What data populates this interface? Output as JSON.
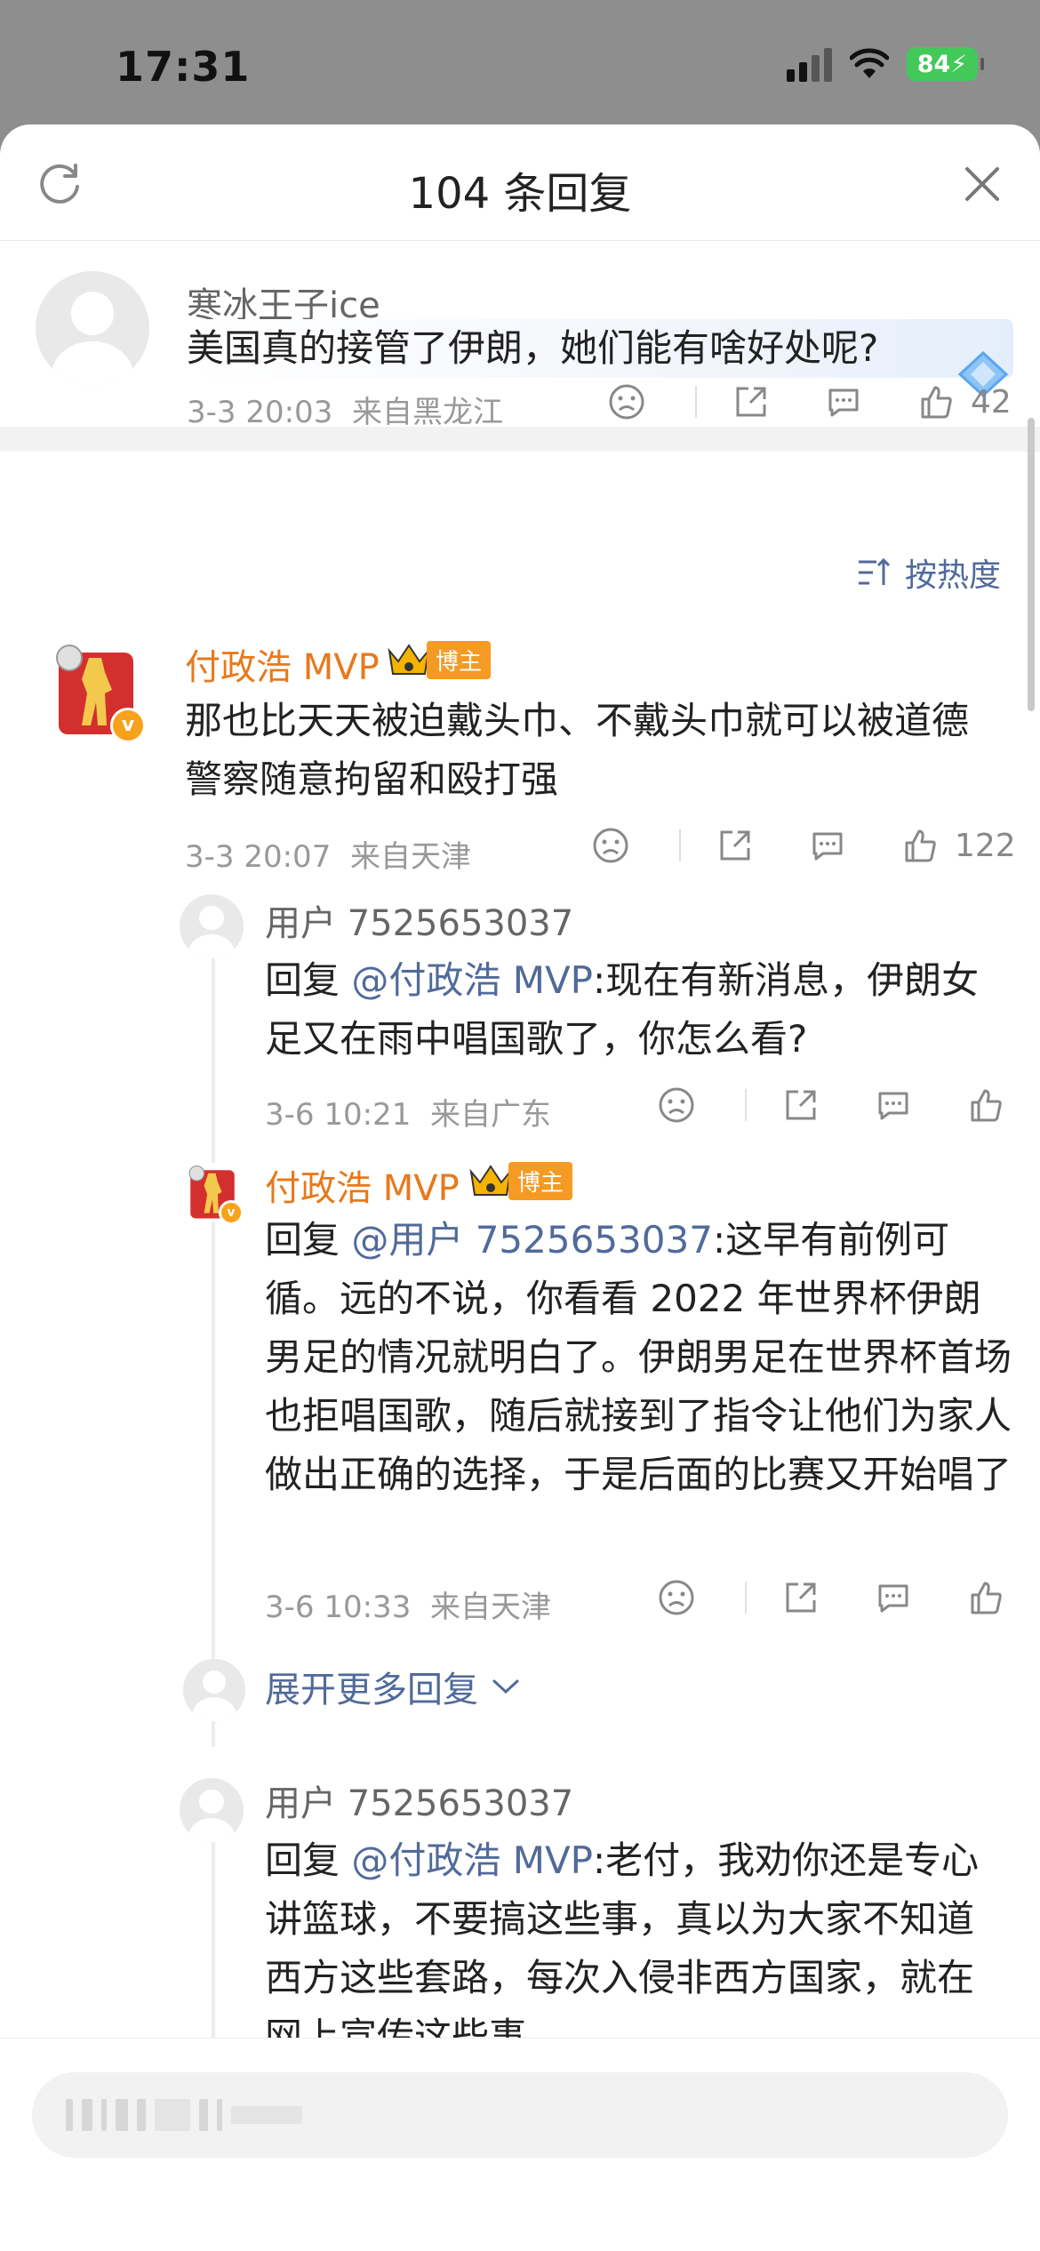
{
  "status_bar": {
    "time": "17:31",
    "battery": "84"
  },
  "header": {
    "title": "104 条回复"
  },
  "top_comment": {
    "username": "寒冰王子ice",
    "text": "美国真的接管了伊朗，她们能有啥好处呢?",
    "time": "3-3 20:03",
    "location": "来自黑龙江",
    "likes": "42"
  },
  "sort_label": "按热度",
  "main_comment": {
    "username": "付政浩 MVP",
    "badge": "博主",
    "text": "那也比天天被迫戴头巾、不戴头巾就可以被道德警察随意拘留和殴打强",
    "time": "3-3 20:07",
    "location": "来自天津",
    "likes": "122"
  },
  "replies": [
    {
      "username": "用户 7525653037",
      "reply_prefix": "回复 ",
      "mention": "@付政浩 MVP",
      "text": ":现在有新消息，伊朗女足又在雨中唱国歌了，你怎么看?",
      "time": "3-6 10:21",
      "location": "来自广东"
    },
    {
      "username": "付政浩 MVP",
      "badge": "博主",
      "reply_prefix": "回复 ",
      "mention": "@用户 7525653037",
      "text": ":这早有前例可循。远的不说，你看看 2022 年世界杯伊朗男足的情况就明白了。伊朗男足在世界杯首场也拒唱国歌，随后就接到了指令让他们为家人做出正确的选择，于是后面的比赛又开始唱了",
      "time": "3-6 10:33",
      "location": "来自天津"
    }
  ],
  "expand_more": "展开更多回复",
  "next_comment": {
    "username": "用户 7525653037",
    "reply_prefix": "回复 ",
    "mention": "@付政浩 MVP",
    "text": ":老付，我劝你还是专心讲篮球，不要搞这些事，真以为大家不知道西方这些套路，每次入侵非西方国家，就在网上宣传这些事"
  },
  "colors": {
    "accent_blue": "#506a9a",
    "name_orange": "#e8791b",
    "badge_orange": "#f59a23"
  }
}
